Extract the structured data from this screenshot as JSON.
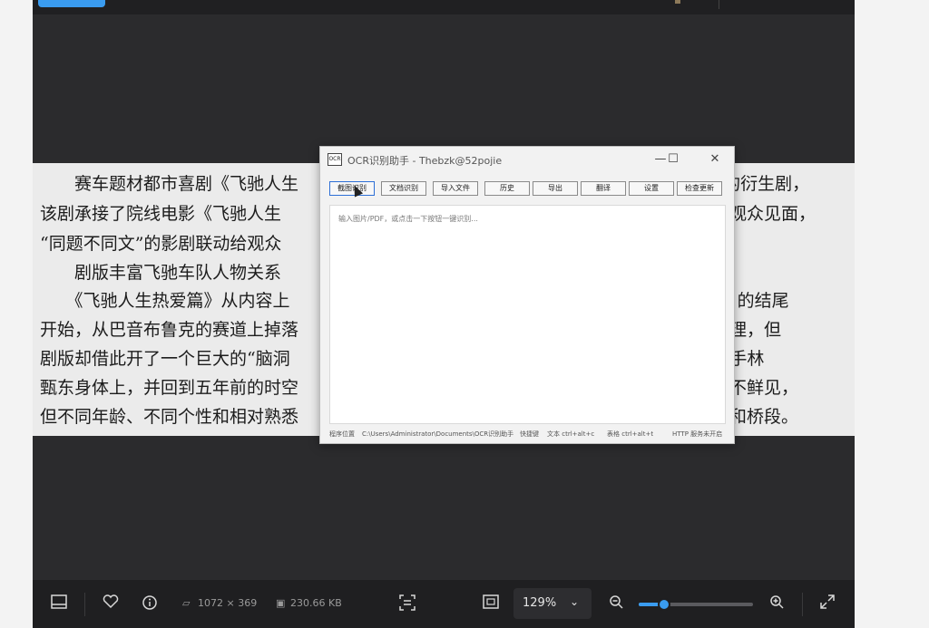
{
  "viewer": {
    "document_lines": [
      "　　赛车题材都市喜剧《飞驰人生　　　　　　　　　　　　　　　　　　　　　　　1》的衍生剧，",
      "该剧承接了院线电影《飞驰人生　　　　　　　　　　　　　　　　　　　　　　　　规与观众见面，",
      "“同题不同文”的影剧联动给观众",
      "　　剧版丰富飞驰车队人物关系",
      "　　《飞驰人生热爱篇》从内容上　　　　　　　　　　　　　　　　　　　　　　　生 1》的结尾",
      "开始，从巴音布鲁克的赛道上掉落　　　　　　　　　　　　　　　　　　　　　　术化处理，但",
      "剧版却借此开了一个巨大的“脑洞　　　　　　　　　　　　　　　　　　　　　　越”到对手林",
      "甄东身体上，并回到五年前的时空　　　　　　　　　　　　　　　　　　　　　　剧中并不鲜见，",
      "但不同年龄、不同个性和相对熟悉　　　　　　　　　　　　　　　　　　　　　　约冲突和桥段。"
    ],
    "bottom_bar": {
      "dimensions": "1072 × 369",
      "file_size": "230.66 KB",
      "zoom_level": "129%",
      "zoom_fraction": 0.22
    }
  },
  "ocr_window": {
    "title": "OCR识别助手 - Thebzk@52pojie",
    "toolbar": [
      "截图识别",
      "文档识别",
      "导入文件",
      "历史",
      "导出",
      "翻译",
      "设置",
      "检查更新"
    ],
    "placeholder": "输入图片/PDF，或点击一下按钮一键识别...",
    "status": {
      "path_label": "程序位置",
      "path_value": "C:\\Users\\Administrator\\Documents\\OCR识别助手",
      "hotkeys_label": "快捷键",
      "hotkey_text": "文本 ctrl+alt+c",
      "hotkey_table": "表格 ctrl+alt+t",
      "http": "HTTP 服务未开启"
    }
  }
}
